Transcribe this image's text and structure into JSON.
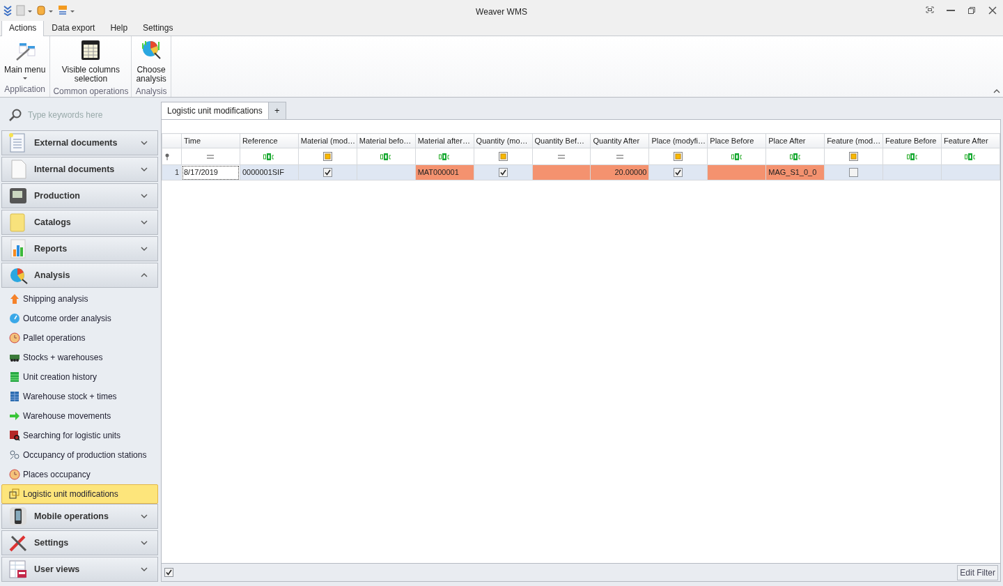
{
  "window": {
    "title": "Weaver WMS"
  },
  "ribbon": {
    "tabs": [
      {
        "label": "Actions",
        "selected": true
      },
      {
        "label": "Data export",
        "selected": false
      },
      {
        "label": "Help",
        "selected": false
      },
      {
        "label": "Settings",
        "selected": false
      }
    ],
    "groups": [
      {
        "caption": "Application",
        "buttons": [
          {
            "label_lines": [
              "Main menu"
            ],
            "dropdown": true
          }
        ]
      },
      {
        "caption": "Common operations",
        "buttons": [
          {
            "label_lines": [
              "Visible columns",
              "selection"
            ],
            "dropdown": false
          }
        ]
      },
      {
        "caption": "Analysis",
        "buttons": [
          {
            "label_lines": [
              "Choose",
              "analysis"
            ],
            "dropdown": false
          }
        ]
      }
    ]
  },
  "sidebar": {
    "search": {
      "placeholder": "Type keywords here"
    },
    "groups": [
      {
        "label": "External documents",
        "expanded": false
      },
      {
        "label": "Internal documents",
        "expanded": false
      },
      {
        "label": "Production",
        "expanded": false
      },
      {
        "label": "Catalogs",
        "expanded": false
      },
      {
        "label": "Reports",
        "expanded": false
      },
      {
        "label": "Analysis",
        "expanded": true,
        "items": [
          {
            "label": "Shipping analysis",
            "selected": false
          },
          {
            "label": "Outcome order analysis",
            "selected": false
          },
          {
            "label": "Pallet operations",
            "selected": false
          },
          {
            "label": "Stocks + warehouses",
            "selected": false
          },
          {
            "label": "Unit creation history",
            "selected": false
          },
          {
            "label": "Warehouse stock + times",
            "selected": false
          },
          {
            "label": "Warehouse movements",
            "selected": false
          },
          {
            "label": "Searching for logistic units",
            "selected": false
          },
          {
            "label": "Occupancy of production stations",
            "selected": false
          },
          {
            "label": "Places occupancy",
            "selected": false
          },
          {
            "label": "Logistic unit modifications",
            "selected": true
          }
        ]
      },
      {
        "label": "Mobile operations",
        "expanded": false
      },
      {
        "label": "Settings",
        "expanded": false
      },
      {
        "label": "User views",
        "expanded": false
      }
    ]
  },
  "document_tabs": [
    {
      "label": "Logistic unit modifications",
      "selected": true
    }
  ],
  "new_tab_button": "+",
  "grid": {
    "columns": [
      {
        "label": "Time",
        "kind": "equals"
      },
      {
        "label": "Reference",
        "kind": "text"
      },
      {
        "label": "Material (mod…",
        "kind": "check"
      },
      {
        "label": "Material befo…",
        "kind": "text"
      },
      {
        "label": "Material after…",
        "kind": "text"
      },
      {
        "label": "Quantity (mo…",
        "kind": "check"
      },
      {
        "label": "Quantity Bef…",
        "kind": "equals"
      },
      {
        "label": "Quantity After",
        "kind": "equals"
      },
      {
        "label": "Place (modyfi…",
        "kind": "check"
      },
      {
        "label": "Place Before",
        "kind": "text"
      },
      {
        "label": "Place After",
        "kind": "text"
      },
      {
        "label": "Feature (mod…",
        "kind": "check"
      },
      {
        "label": "Feature Before",
        "kind": "text"
      },
      {
        "label": "Feature After",
        "kind": "text"
      }
    ],
    "rows": [
      {
        "number": "1",
        "selected": true,
        "cells": [
          {
            "kind": "text",
            "value": "8/17/2019",
            "focused": true,
            "highlighted": false
          },
          {
            "kind": "text",
            "value": "0000001SIF",
            "focused": false,
            "highlighted": false
          },
          {
            "kind": "check",
            "checked": true
          },
          {
            "kind": "text",
            "focused": false,
            "highlighted": false
          },
          {
            "kind": "text",
            "value": "MAT000001",
            "focused": false,
            "highlighted": true
          },
          {
            "kind": "check",
            "checked": true
          },
          {
            "kind": "text",
            "focused": false,
            "highlighted": true
          },
          {
            "kind": "number",
            "value": "20.00000",
            "focused": false,
            "highlighted": true
          },
          {
            "kind": "check",
            "checked": true
          },
          {
            "kind": "text",
            "focused": false,
            "highlighted": true
          },
          {
            "kind": "text",
            "value": "MAG_S1_0_0",
            "focused": false,
            "highlighted": true
          },
          {
            "kind": "check",
            "checked": false
          },
          {
            "kind": "text",
            "focused": false,
            "highlighted": false
          },
          {
            "kind": "text",
            "focused": false,
            "highlighted": false
          }
        ]
      }
    ],
    "filter_panel": {
      "enabled": true,
      "edit_button": "Edit Filter"
    }
  }
}
